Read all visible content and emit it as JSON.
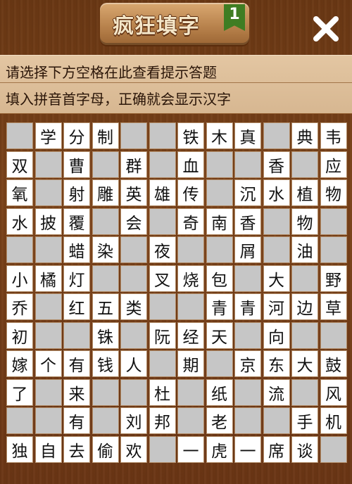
{
  "header": {
    "title": "疯狂填字",
    "level": "1",
    "close_icon": "close-x-icon"
  },
  "hint": {
    "line1": "请选择下方空格在此查看提示答题",
    "line2": "填入拼音首字母，正确就会显示汉字"
  },
  "colors": {
    "wood": "#7a4219",
    "hint_bg": "#e3c6a2",
    "cell_filled": "#ffffff",
    "cell_empty": "#c6c6c6",
    "flag": "#3f7d23"
  },
  "grid": {
    "cols": 12,
    "rows": 12,
    "cells": [
      [
        "",
        "学",
        "分",
        "制",
        "",
        "",
        "铁",
        "木",
        "真",
        "",
        "典",
        "韦"
      ],
      [
        "双",
        "",
        "曹",
        "",
        "群",
        "",
        "血",
        "",
        "",
        "香",
        "",
        "应"
      ],
      [
        "氧",
        "",
        "射",
        "雕",
        "英",
        "雄",
        "传",
        "",
        "沉",
        "水",
        "植",
        "物"
      ],
      [
        "水",
        "披",
        "覆",
        "",
        "会",
        "",
        "奇",
        "南",
        "香",
        "",
        "物",
        ""
      ],
      [
        "",
        "",
        "蜡",
        "染",
        "",
        "夜",
        "",
        "",
        "屑",
        "",
        "油",
        ""
      ],
      [
        "小",
        "橘",
        "灯",
        "",
        "",
        "叉",
        "烧",
        "包",
        "",
        "大",
        "",
        "野"
      ],
      [
        "乔",
        "",
        "红",
        "五",
        "类",
        "",
        "",
        "青",
        "青",
        "河",
        "边",
        "草"
      ],
      [
        "初",
        "",
        "",
        "铢",
        "",
        "阮",
        "经",
        "天",
        "",
        "向",
        "",
        ""
      ],
      [
        "嫁",
        "个",
        "有",
        "钱",
        "人",
        "",
        "期",
        "",
        "京",
        "东",
        "大",
        "鼓"
      ],
      [
        "了",
        "",
        "来",
        "",
        "",
        "杜",
        "",
        "纸",
        "",
        "流",
        "",
        "风"
      ],
      [
        "",
        "",
        "有",
        "",
        "刘",
        "邦",
        "",
        "老",
        "",
        "",
        "手",
        "机"
      ],
      [
        "独",
        "自",
        "去",
        "偷",
        "欢",
        "",
        "一",
        "虎",
        "一",
        "席",
        "谈",
        ""
      ]
    ]
  }
}
